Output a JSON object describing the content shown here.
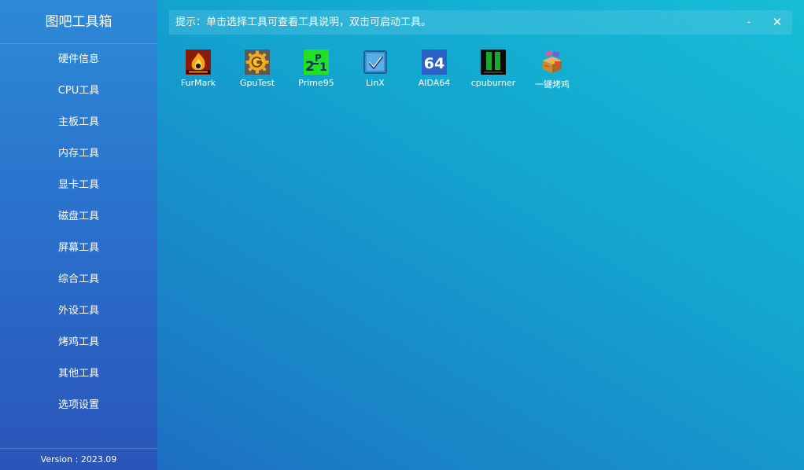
{
  "app": {
    "title": "图吧工具箱",
    "version": "Version : 2023.09"
  },
  "sidebar": {
    "items": [
      {
        "label": "硬件信息"
      },
      {
        "label": "CPU工具"
      },
      {
        "label": "主板工具"
      },
      {
        "label": "内存工具"
      },
      {
        "label": "显卡工具"
      },
      {
        "label": "磁盘工具"
      },
      {
        "label": "屏幕工具"
      },
      {
        "label": "综合工具"
      },
      {
        "label": "外设工具"
      },
      {
        "label": "烤鸡工具"
      },
      {
        "label": "其他工具"
      },
      {
        "label": "选项设置"
      }
    ]
  },
  "hint": {
    "text": "提示：单击选择工具可查看工具说明，双击可启动工具。",
    "minimize_label": "-",
    "close_label": "✕"
  },
  "tools": [
    {
      "label": "FurMark",
      "icon": "furmark-icon"
    },
    {
      "label": "GpuTest",
      "icon": "gputest-icon"
    },
    {
      "label": "Prime95",
      "icon": "prime95-icon"
    },
    {
      "label": "LinX",
      "icon": "linx-icon"
    },
    {
      "label": "AIDA64",
      "icon": "aida64-icon",
      "icon_text": "64"
    },
    {
      "label": "cpuburner",
      "icon": "cpuburner-icon"
    },
    {
      "label": "一键烤鸡",
      "icon": "one-click-stress-icon"
    }
  ],
  "colors": {
    "background_top": "#17bdd6",
    "background_bottom": "#1f62bf",
    "sidebar_top": "#2c8ad6",
    "sidebar_bottom": "#2a55b8",
    "text": "#ffffff"
  }
}
